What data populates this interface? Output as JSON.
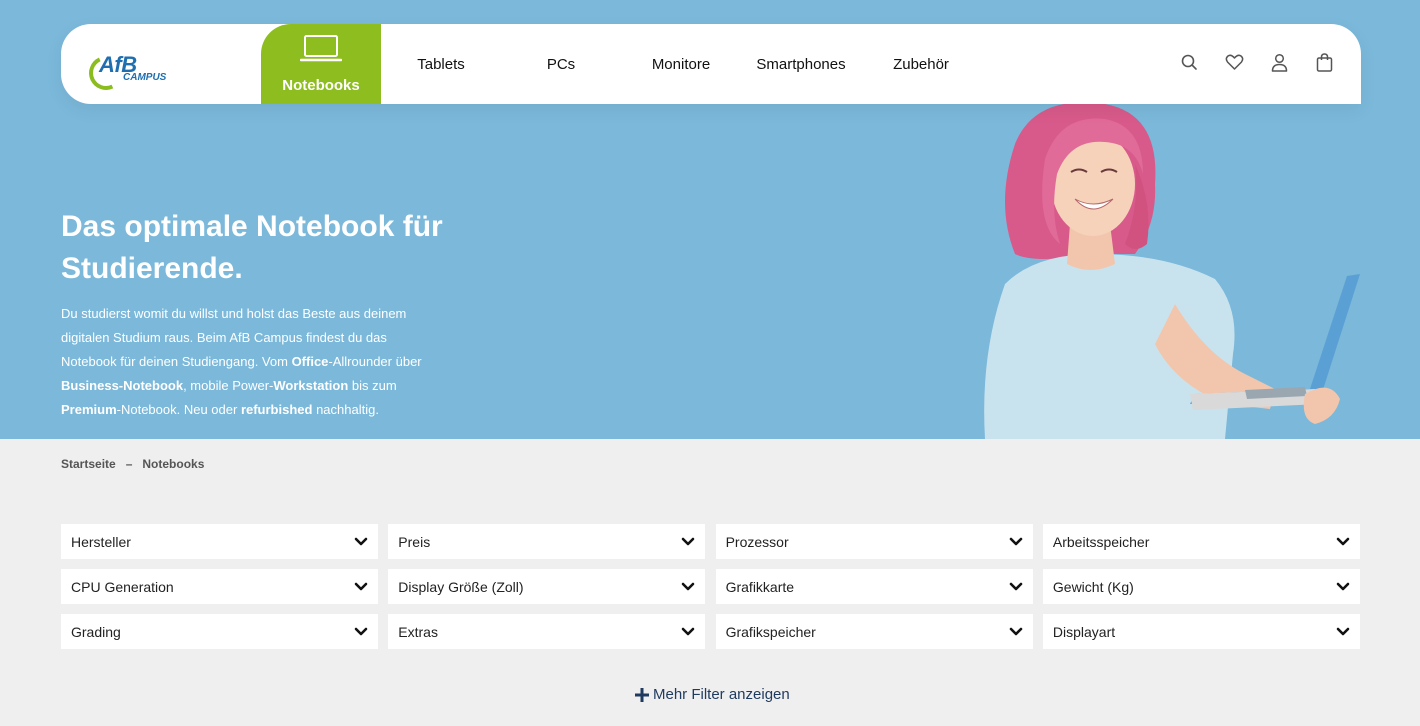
{
  "nav": {
    "logo_text": "AfB",
    "logo_sub": "CAMPUS",
    "active": {
      "label": "Notebooks",
      "icon": "laptop-icon"
    },
    "items": [
      {
        "label": "Tablets"
      },
      {
        "label": "PCs"
      },
      {
        "label": "Monitore"
      },
      {
        "label": "Smartphones"
      },
      {
        "label": "Zubehör"
      }
    ],
    "icons": [
      "search-icon",
      "heart-icon",
      "user-icon",
      "shopping-bag-icon"
    ]
  },
  "hero": {
    "title": "Das optimale Notebook für Studierende.",
    "text_parts": {
      "p1": "Du studierst womit du willst und holst das Beste aus deinem digitalen Studium raus. Beim AfB Campus findest du das Notebook für deinen Studiengang. Vom ",
      "office": "Office",
      "p2": "-Allrounder über ",
      "business": "Business-Notebook",
      "p3": ", mobile Power-",
      "workstation": "Workstation",
      "p4": " bis zum ",
      "premium": "Premium",
      "p5": "-Notebook. Neu oder ",
      "refurbished": "refurbished",
      "p6": " nachhaltig."
    },
    "background_color": "#7bb8da"
  },
  "breadcrumb": {
    "home": "Startseite",
    "separator": "–",
    "current": "Notebooks"
  },
  "filters": [
    {
      "label": "Hersteller"
    },
    {
      "label": "Preis"
    },
    {
      "label": "Prozessor"
    },
    {
      "label": "Arbeitsspeicher"
    },
    {
      "label": "CPU Generation"
    },
    {
      "label": "Display Größe (Zoll)"
    },
    {
      "label": "Grafikkarte"
    },
    {
      "label": "Gewicht (Kg)"
    },
    {
      "label": "Grading"
    },
    {
      "label": "Extras"
    },
    {
      "label": "Grafikspeicher"
    },
    {
      "label": "Displayart"
    }
  ],
  "more_filters": {
    "icon": "plus-icon",
    "label": "Mehr Filter anzeigen"
  },
  "colors": {
    "accent_green": "#8ebd1f",
    "brand_blue": "#1f6fb0",
    "link_navy": "#1f3a5f"
  }
}
